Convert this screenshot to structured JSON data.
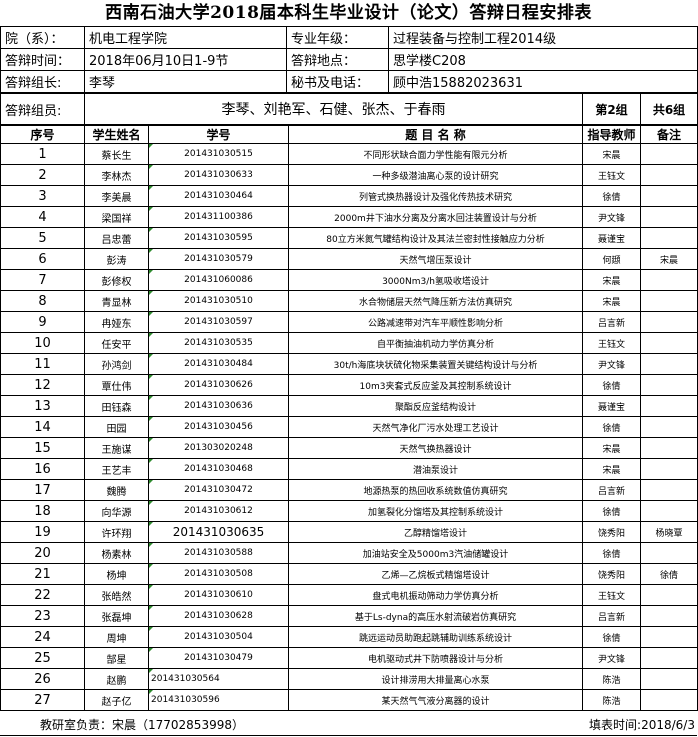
{
  "title": "西南石油大学2018届本科生毕业设计（论文）答辩日程安排表",
  "info": {
    "college_label": "院（系）：",
    "college_value": "机电工程学院",
    "major_label": "专业年级：",
    "major_value": "过程装备与控制工程2014级",
    "time_label": "答辩时间：",
    "time_value": "2018年06月10日1-9节",
    "place_label": "答辩地点：",
    "place_value": "思学楼C208",
    "leader_label": "答辩组长:",
    "leader_value": "李琴",
    "secretary_label": "秘书及电话：",
    "secretary_value": "顾中浩15882023631",
    "members_label": "答辩组员:",
    "members_value": "李琴、刘艳军、石健、张杰、于春雨",
    "group_no": "第2组",
    "group_total": "共6组"
  },
  "headers": {
    "index": "序号",
    "student": "学生姓名",
    "student_id": "学号",
    "topic": "题 目 名 称",
    "advisor": "指导教师",
    "note": "备注"
  },
  "rows": [
    {
      "index": "1",
      "student": "蔡长生",
      "student_id": "201431030515",
      "topic": "不同形状缺合面力学性能有限元分析",
      "advisor": "宋晨",
      "note": ""
    },
    {
      "index": "2",
      "student": "李林杰",
      "student_id": "201431030633",
      "topic": "一种多级潜油离心泵的设计研究",
      "advisor": "王钰文",
      "note": ""
    },
    {
      "index": "3",
      "student": "李美晨",
      "student_id": "201431030464",
      "topic": "列管式换热器设计及强化传热技术研究",
      "advisor": "徐倩",
      "note": ""
    },
    {
      "index": "4",
      "student": "梁国祥",
      "student_id": "201431100386",
      "topic": "2000m井下油水分离及分离水回注装置设计与分析",
      "advisor": "尹文锋",
      "note": ""
    },
    {
      "index": "5",
      "student": "吕忠蕾",
      "student_id": "201431030595",
      "topic": "80立方米氮气罐结构设计及其法兰密封性接触应力分析",
      "advisor": "聂谨宝",
      "note": ""
    },
    {
      "index": "6",
      "student": "彭涛",
      "student_id": "201431030579",
      "topic": "天然气增压泵设计",
      "advisor": "何頲",
      "note": "宋晨"
    },
    {
      "index": "7",
      "student": "彭修权",
      "student_id": "201431060086",
      "topic": "3000Nm3/h氢吸收塔设计",
      "advisor": "宋晨",
      "note": ""
    },
    {
      "index": "8",
      "student": "青显林",
      "student_id": "201431030510",
      "topic": "水合物储层天然气降压新方法仿真研究",
      "advisor": "宋晨",
      "note": ""
    },
    {
      "index": "9",
      "student": "冉娅东",
      "student_id": "201431030597",
      "topic": "公路减速带对汽车平顺性影响分析",
      "advisor": "吕言新",
      "note": ""
    },
    {
      "index": "10",
      "student": "任安平",
      "student_id": "201431030535",
      "topic": "自平衡抽油机动力学仿真分析",
      "advisor": "王钰文",
      "note": ""
    },
    {
      "index": "11",
      "student": "孙鸿剑",
      "student_id": "201431030484",
      "topic": "30t/h海底块状硫化物采集装置关键结构设计与分析",
      "advisor": "尹文锋",
      "note": ""
    },
    {
      "index": "12",
      "student": "覃仕伟",
      "student_id": "201431030626",
      "topic": "10m3夹套式反应釜及其控制系统设计",
      "advisor": "徐倩",
      "note": ""
    },
    {
      "index": "13",
      "student": "田钰森",
      "student_id": "201431030636",
      "topic": "聚酯反应釜结构设计",
      "advisor": "聂谨宝",
      "note": ""
    },
    {
      "index": "14",
      "student": "田园",
      "student_id": "201431030456",
      "topic": "天然气净化厂污水处理工艺设计",
      "advisor": "徐倩",
      "note": ""
    },
    {
      "index": "15",
      "student": "王施谋",
      "student_id": "201303020248",
      "topic": "天然气换热器设计",
      "advisor": "宋晨",
      "note": ""
    },
    {
      "index": "16",
      "student": "王艺丰",
      "student_id": "201431030468",
      "topic": "潜油泵设计",
      "advisor": "宋晨",
      "note": ""
    },
    {
      "index": "17",
      "student": "魏腾",
      "student_id": "201431030472",
      "topic": "地源热泵的热回收系统数值仿真研究",
      "advisor": "吕言新",
      "note": ""
    },
    {
      "index": "18",
      "student": "向华源",
      "student_id": "201431030612",
      "topic": "加氢裂化分馏塔及其控制系统设计",
      "advisor": "徐倩",
      "note": ""
    },
    {
      "index": "19",
      "student": "许环翔",
      "student_id": "201431030635",
      "topic": "乙醇精馏塔设计",
      "advisor": "饶秀阳",
      "note": "杨晓覃"
    },
    {
      "index": "20",
      "student": "杨素林",
      "student_id": "201431030588",
      "topic": "加油站安全及5000m3汽油储罐设计",
      "advisor": "徐倩",
      "note": ""
    },
    {
      "index": "21",
      "student": "杨坤",
      "student_id": "201431030508",
      "topic": "乙烯—乙烷板式精馏塔设计",
      "advisor": "饶秀阳",
      "note": "徐倩"
    },
    {
      "index": "22",
      "student": "张皓然",
      "student_id": "201431030610",
      "topic": "盘式电机振动筛动力学仿真分析",
      "advisor": "王钰文",
      "note": ""
    },
    {
      "index": "23",
      "student": "张磊坤",
      "student_id": "201431030628",
      "topic": "基于Ls-dyna的高压水射流破岩仿真研究",
      "advisor": "吕言新",
      "note": ""
    },
    {
      "index": "24",
      "student": "周坤",
      "student_id": "201431030504",
      "topic": "跳远运动员助跑起跳辅助训练系统设计",
      "advisor": "徐倩",
      "note": ""
    },
    {
      "index": "25",
      "student": "郜星",
      "student_id": "201431030479",
      "topic": "电机驱动式井下防喷器设计与分析",
      "advisor": "尹文锋",
      "note": ""
    },
    {
      "index": "26",
      "student": "赵鹏",
      "student_id": "201431030564",
      "topic": "设计排涝用大排量离心水泵",
      "advisor": "陈浩",
      "note": ""
    },
    {
      "index": "27",
      "student": "赵子亿",
      "student_id": "201431030596",
      "topic": "某天然气气液分离器的设计",
      "advisor": "陈浩",
      "note": ""
    }
  ],
  "footer": {
    "contact": "教研室负责：宋晨（17702853998）",
    "filled": "填表时间:2018/6/3"
  }
}
